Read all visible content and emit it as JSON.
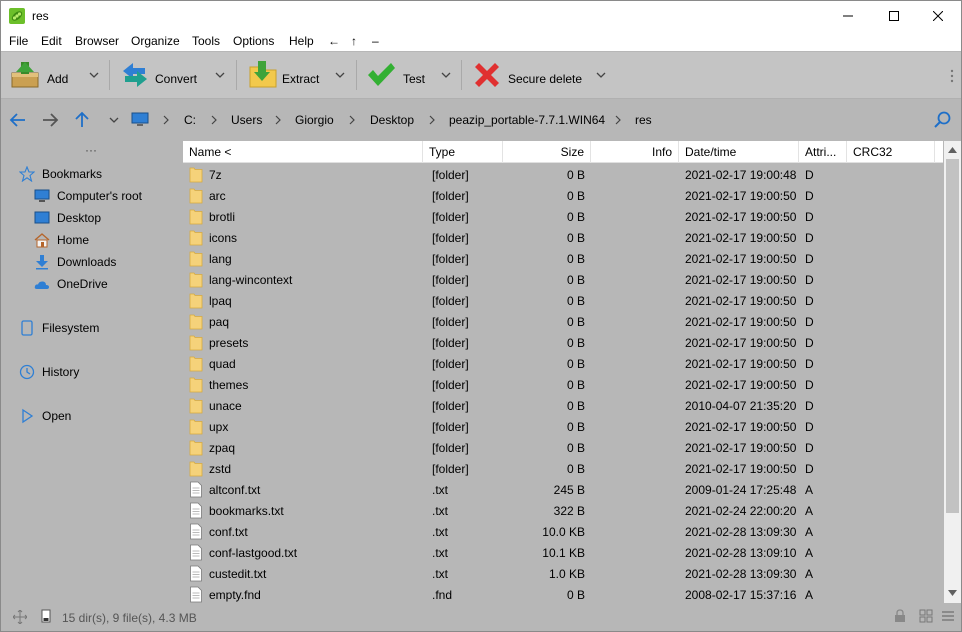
{
  "window": {
    "title": "res"
  },
  "menu": [
    "File",
    "Edit",
    "Browser",
    "Organize",
    "Tools",
    "Options",
    "Help",
    "←",
    "↑",
    "–"
  ],
  "toolbar": {
    "buttons": [
      {
        "label": "Add",
        "icon": "add-archive-icon"
      },
      {
        "label": "Convert",
        "icon": "convert-icon"
      },
      {
        "label": "Extract",
        "icon": "extract-icon"
      },
      {
        "label": "Test",
        "icon": "test-checkmark-icon"
      },
      {
        "label": "Secure delete",
        "icon": "secure-delete-x-icon"
      }
    ]
  },
  "breadcrumb": [
    "C:",
    "Users",
    "Giorgio",
    "Desktop",
    "peazip_portable-7.7.1.WIN64",
    "res"
  ],
  "sidebar": {
    "more": "···",
    "bookmarks_label": "Bookmarks",
    "bookmarks": [
      "Computer's root",
      "Desktop",
      "Home",
      "Downloads",
      "OneDrive"
    ],
    "sections": [
      "Filesystem",
      "History",
      "Open"
    ]
  },
  "columns": {
    "name": "Name <",
    "type": "Type",
    "size": "Size",
    "info": "Info",
    "datetime": "Date/time",
    "attrib": "Attri...",
    "crc": "CRC32"
  },
  "files": [
    {
      "name": "7z",
      "type": "[folder]",
      "size": "0 B",
      "date": "2021-02-17 19:00:48",
      "attr": "D",
      "kind": "folder"
    },
    {
      "name": "arc",
      "type": "[folder]",
      "size": "0 B",
      "date": "2021-02-17 19:00:50",
      "attr": "D",
      "kind": "folder"
    },
    {
      "name": "brotli",
      "type": "[folder]",
      "size": "0 B",
      "date": "2021-02-17 19:00:50",
      "attr": "D",
      "kind": "folder"
    },
    {
      "name": "icons",
      "type": "[folder]",
      "size": "0 B",
      "date": "2021-02-17 19:00:50",
      "attr": "D",
      "kind": "folder"
    },
    {
      "name": "lang",
      "type": "[folder]",
      "size": "0 B",
      "date": "2021-02-17 19:00:50",
      "attr": "D",
      "kind": "folder"
    },
    {
      "name": "lang-wincontext",
      "type": "[folder]",
      "size": "0 B",
      "date": "2021-02-17 19:00:50",
      "attr": "D",
      "kind": "folder"
    },
    {
      "name": "lpaq",
      "type": "[folder]",
      "size": "0 B",
      "date": "2021-02-17 19:00:50",
      "attr": "D",
      "kind": "folder"
    },
    {
      "name": "paq",
      "type": "[folder]",
      "size": "0 B",
      "date": "2021-02-17 19:00:50",
      "attr": "D",
      "kind": "folder"
    },
    {
      "name": "presets",
      "type": "[folder]",
      "size": "0 B",
      "date": "2021-02-17 19:00:50",
      "attr": "D",
      "kind": "folder"
    },
    {
      "name": "quad",
      "type": "[folder]",
      "size": "0 B",
      "date": "2021-02-17 19:00:50",
      "attr": "D",
      "kind": "folder"
    },
    {
      "name": "themes",
      "type": "[folder]",
      "size": "0 B",
      "date": "2021-02-17 19:00:50",
      "attr": "D",
      "kind": "folder"
    },
    {
      "name": "unace",
      "type": "[folder]",
      "size": "0 B",
      "date": "2010-04-07 21:35:20",
      "attr": "D",
      "kind": "folder"
    },
    {
      "name": "upx",
      "type": "[folder]",
      "size": "0 B",
      "date": "2021-02-17 19:00:50",
      "attr": "D",
      "kind": "folder"
    },
    {
      "name": "zpaq",
      "type": "[folder]",
      "size": "0 B",
      "date": "2021-02-17 19:00:50",
      "attr": "D",
      "kind": "folder"
    },
    {
      "name": "zstd",
      "type": "[folder]",
      "size": "0 B",
      "date": "2021-02-17 19:00:50",
      "attr": "D",
      "kind": "folder"
    },
    {
      "name": "altconf.txt",
      "type": ".txt",
      "size": "245 B",
      "date": "2009-01-24 17:25:48",
      "attr": "A",
      "kind": "file"
    },
    {
      "name": "bookmarks.txt",
      "type": ".txt",
      "size": "322 B",
      "date": "2021-02-24 22:00:20",
      "attr": "A",
      "kind": "file"
    },
    {
      "name": "conf.txt",
      "type": ".txt",
      "size": "10.0 KB",
      "date": "2021-02-28 13:09:30",
      "attr": "A",
      "kind": "file"
    },
    {
      "name": "conf-lastgood.txt",
      "type": ".txt",
      "size": "10.1 KB",
      "date": "2021-02-28 13:09:10",
      "attr": "A",
      "kind": "file"
    },
    {
      "name": "custedit.txt",
      "type": ".txt",
      "size": "1.0 KB",
      "date": "2021-02-28 13:09:30",
      "attr": "A",
      "kind": "file"
    },
    {
      "name": "empty.fnd",
      "type": ".fnd",
      "size": "0 B",
      "date": "2008-02-17 15:37:16",
      "attr": "A",
      "kind": "file"
    }
  ],
  "status": "15 dir(s), 9 file(s), 4.3 MB"
}
